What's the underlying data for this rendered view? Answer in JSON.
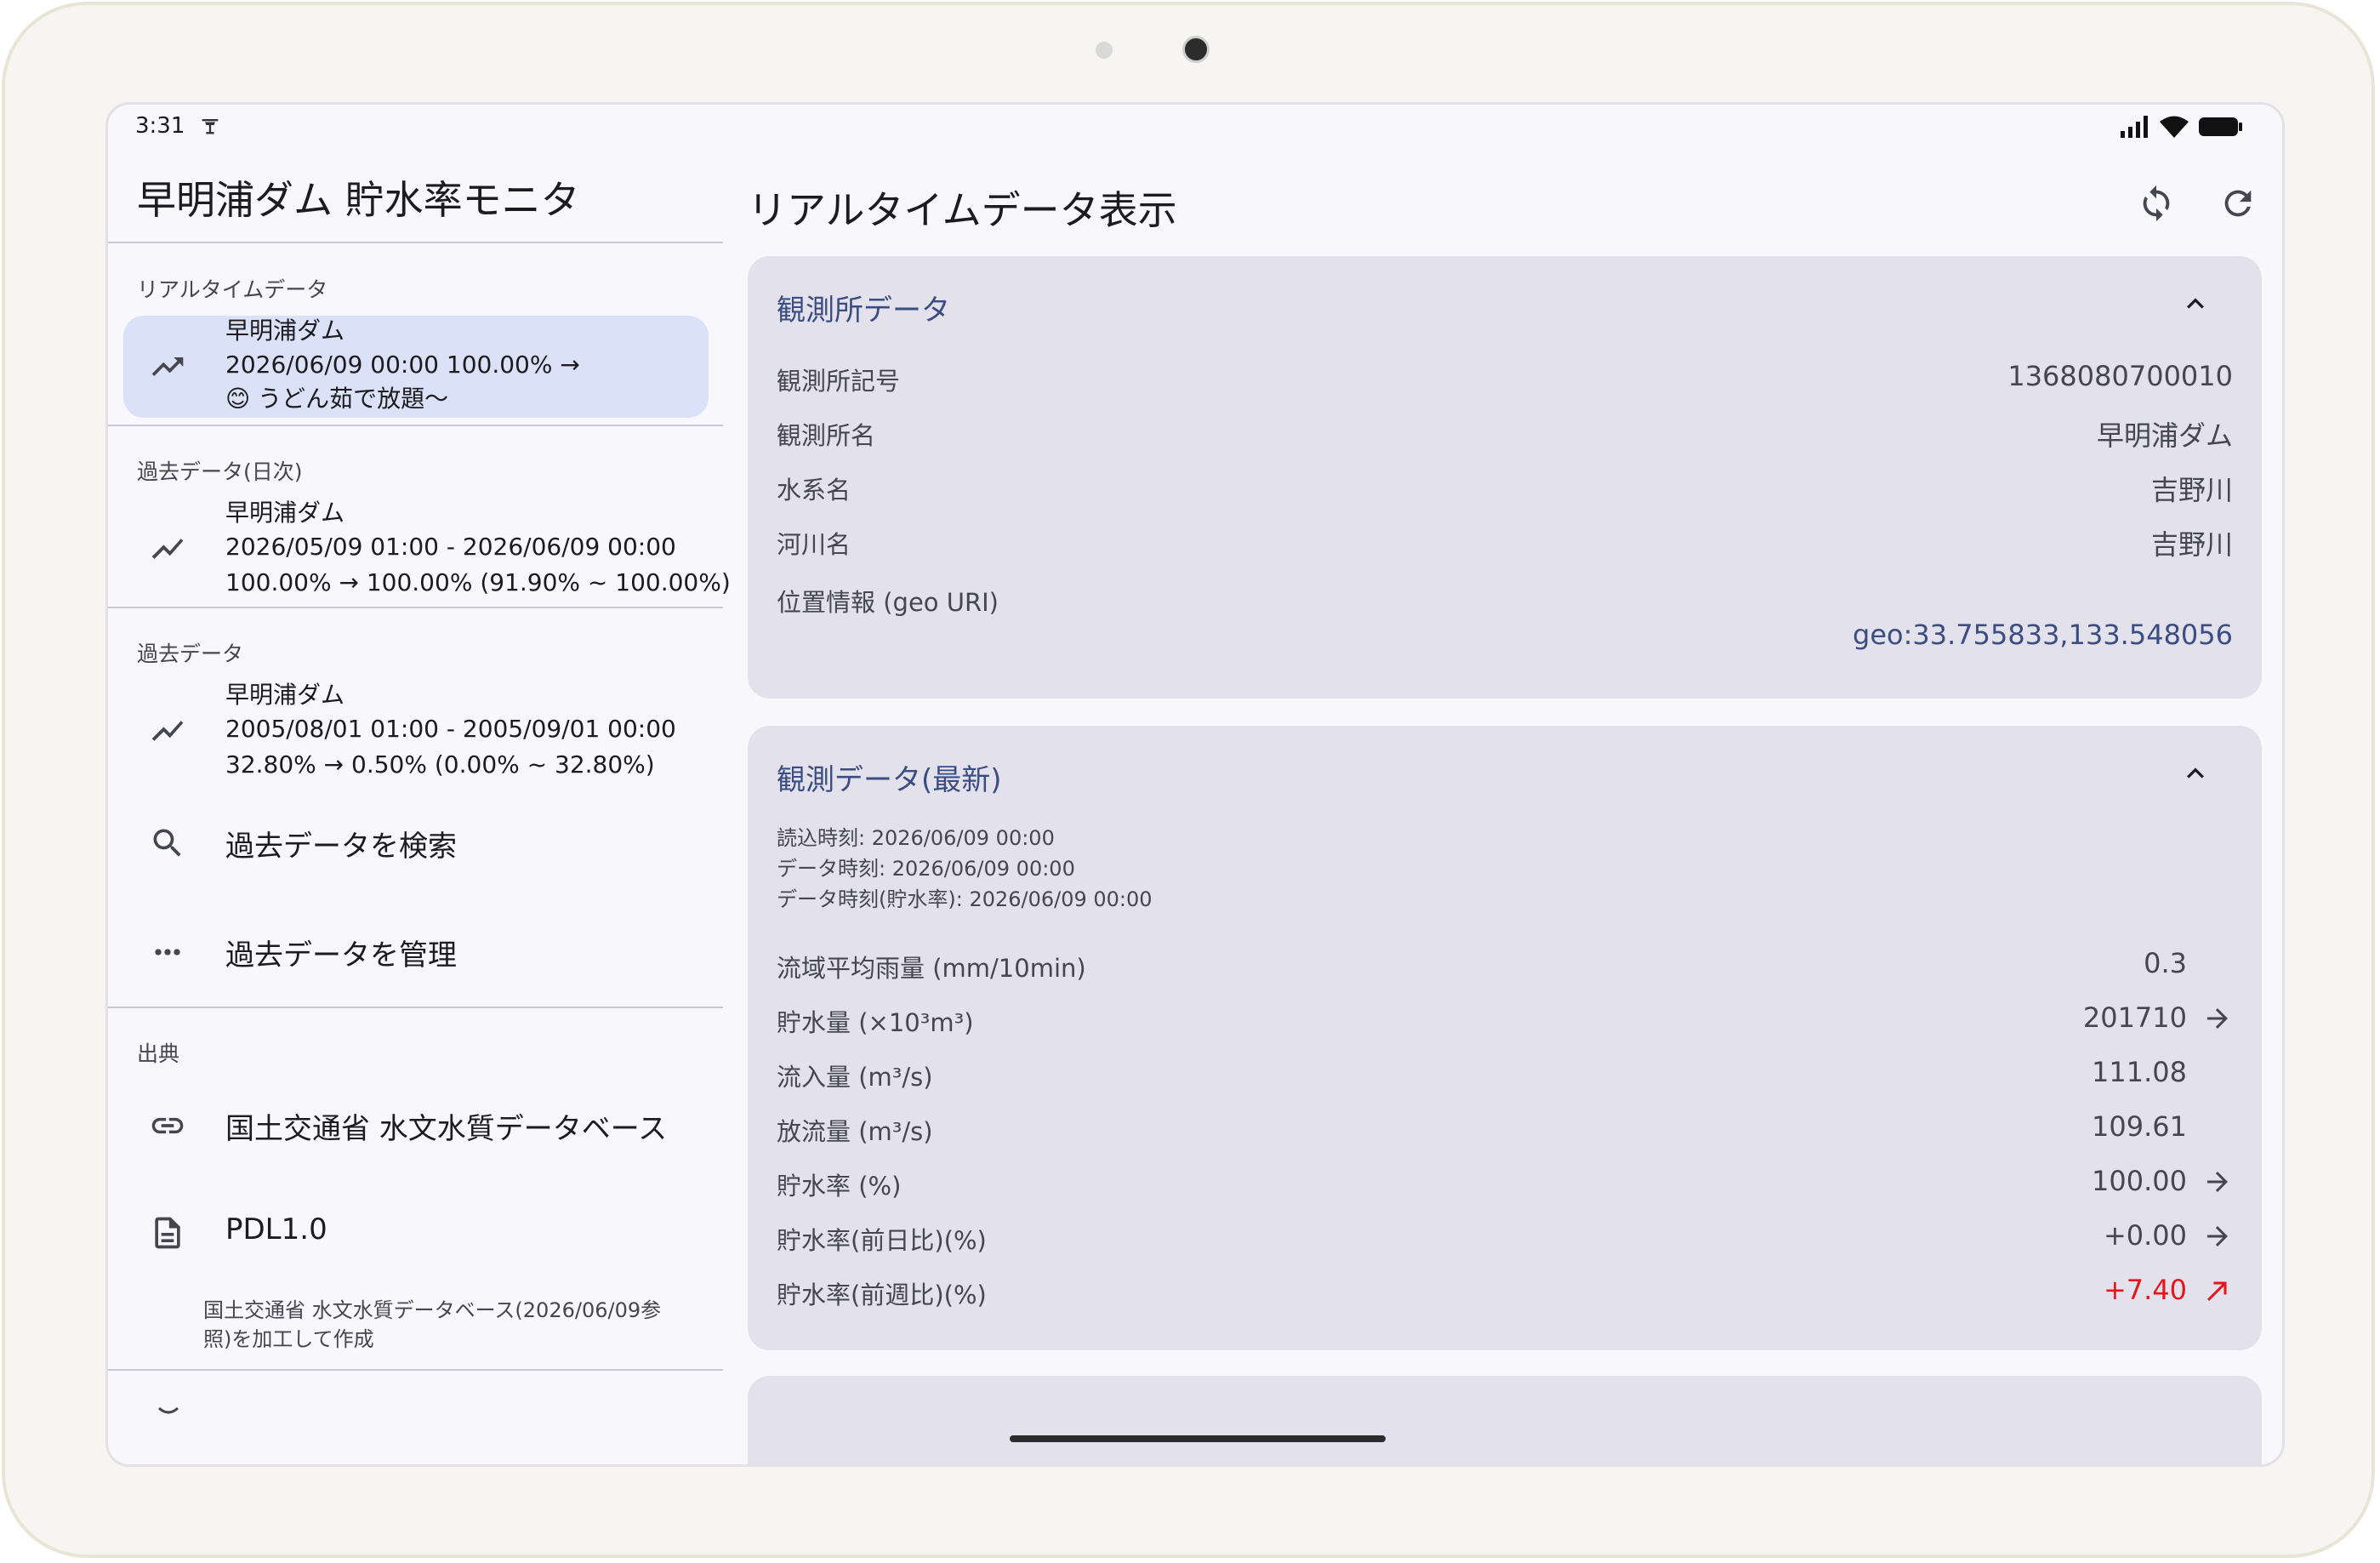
{
  "status": {
    "time": "3:31"
  },
  "sidebar": {
    "app_title": "早明浦ダム 貯水率モニタ",
    "sections": [
      {
        "label": "リアルタイムデータ",
        "item": {
          "line1": "早明浦ダム",
          "line2": "2026/06/09 00:00 100.00% →",
          "line3": "😊 うどん茹で放題〜",
          "icon": "trending-up-icon"
        }
      },
      {
        "label": "過去データ(日次)",
        "item": {
          "line1": "早明浦ダム",
          "line2": "2026/05/09 01:00 - 2026/06/09 00:00",
          "line3": "100.00% → 100.00% (91.90% ~ 100.00%)",
          "icon": "show-chart-icon"
        }
      },
      {
        "label": "過去データ",
        "item": {
          "line1": "早明浦ダム",
          "line2": "2005/08/01 01:00 - 2005/09/01 00:00",
          "line3": "32.80% → 0.50% (0.00% ~ 32.80%)",
          "icon": "show-chart-icon"
        }
      }
    ],
    "search_past": "過去データを検索",
    "manage_past": "過去データを管理",
    "source_label": "出典",
    "source_link": "国土交通省 水文水質データベース",
    "license": "PDL1.0",
    "source_note": "国土交通省 水文水質データベース(2026/06/09参照)を加工して作成"
  },
  "main": {
    "title": "リアルタイムデータ表示",
    "station_card": {
      "title": "観測所データ",
      "rows": [
        {
          "label": "観測所記号",
          "value": "1368080700010"
        },
        {
          "label": "観測所名",
          "value": "早明浦ダム"
        },
        {
          "label": "水系名",
          "value": "吉野川"
        },
        {
          "label": "河川名",
          "value": "吉野川"
        }
      ],
      "geo_label": "位置情報 (geo URI)",
      "geo_value": "geo:33.755833,133.548056"
    },
    "obs_card": {
      "title": "観測データ(最新)",
      "read_time": "読込時刻: 2026/06/09 00:00",
      "data_time": "データ時刻: 2026/06/09 00:00",
      "rate_time": "データ時刻(貯水率): 2026/06/09 00:00",
      "rows": [
        {
          "label": "流域平均雨量 (mm/10min)",
          "value": "0.3",
          "arrow": ""
        },
        {
          "label": "貯水量 (×10³m³)",
          "value": "201710",
          "arrow": "arrow-right-icon"
        },
        {
          "label": "流入量 (m³/s)",
          "value": "111.08",
          "arrow": ""
        },
        {
          "label": "放流量 (m³/s)",
          "value": "109.61",
          "arrow": ""
        },
        {
          "label": "貯水率 (%)",
          "value": "100.00",
          "arrow": "arrow-right-icon"
        },
        {
          "label": "貯水率(前日比)(%)",
          "value": "+0.00",
          "arrow": "arrow-right-icon"
        },
        {
          "label": "貯水率(前週比)(%)",
          "value": "+7.40",
          "arrow": "arrow-up-right-icon"
        }
      ]
    }
  },
  "colors": {
    "accent": "#3c4d82",
    "positive": "#e8141b",
    "card_bg": "#e2e1ec",
    "active_bg": "#dbe1f7"
  }
}
